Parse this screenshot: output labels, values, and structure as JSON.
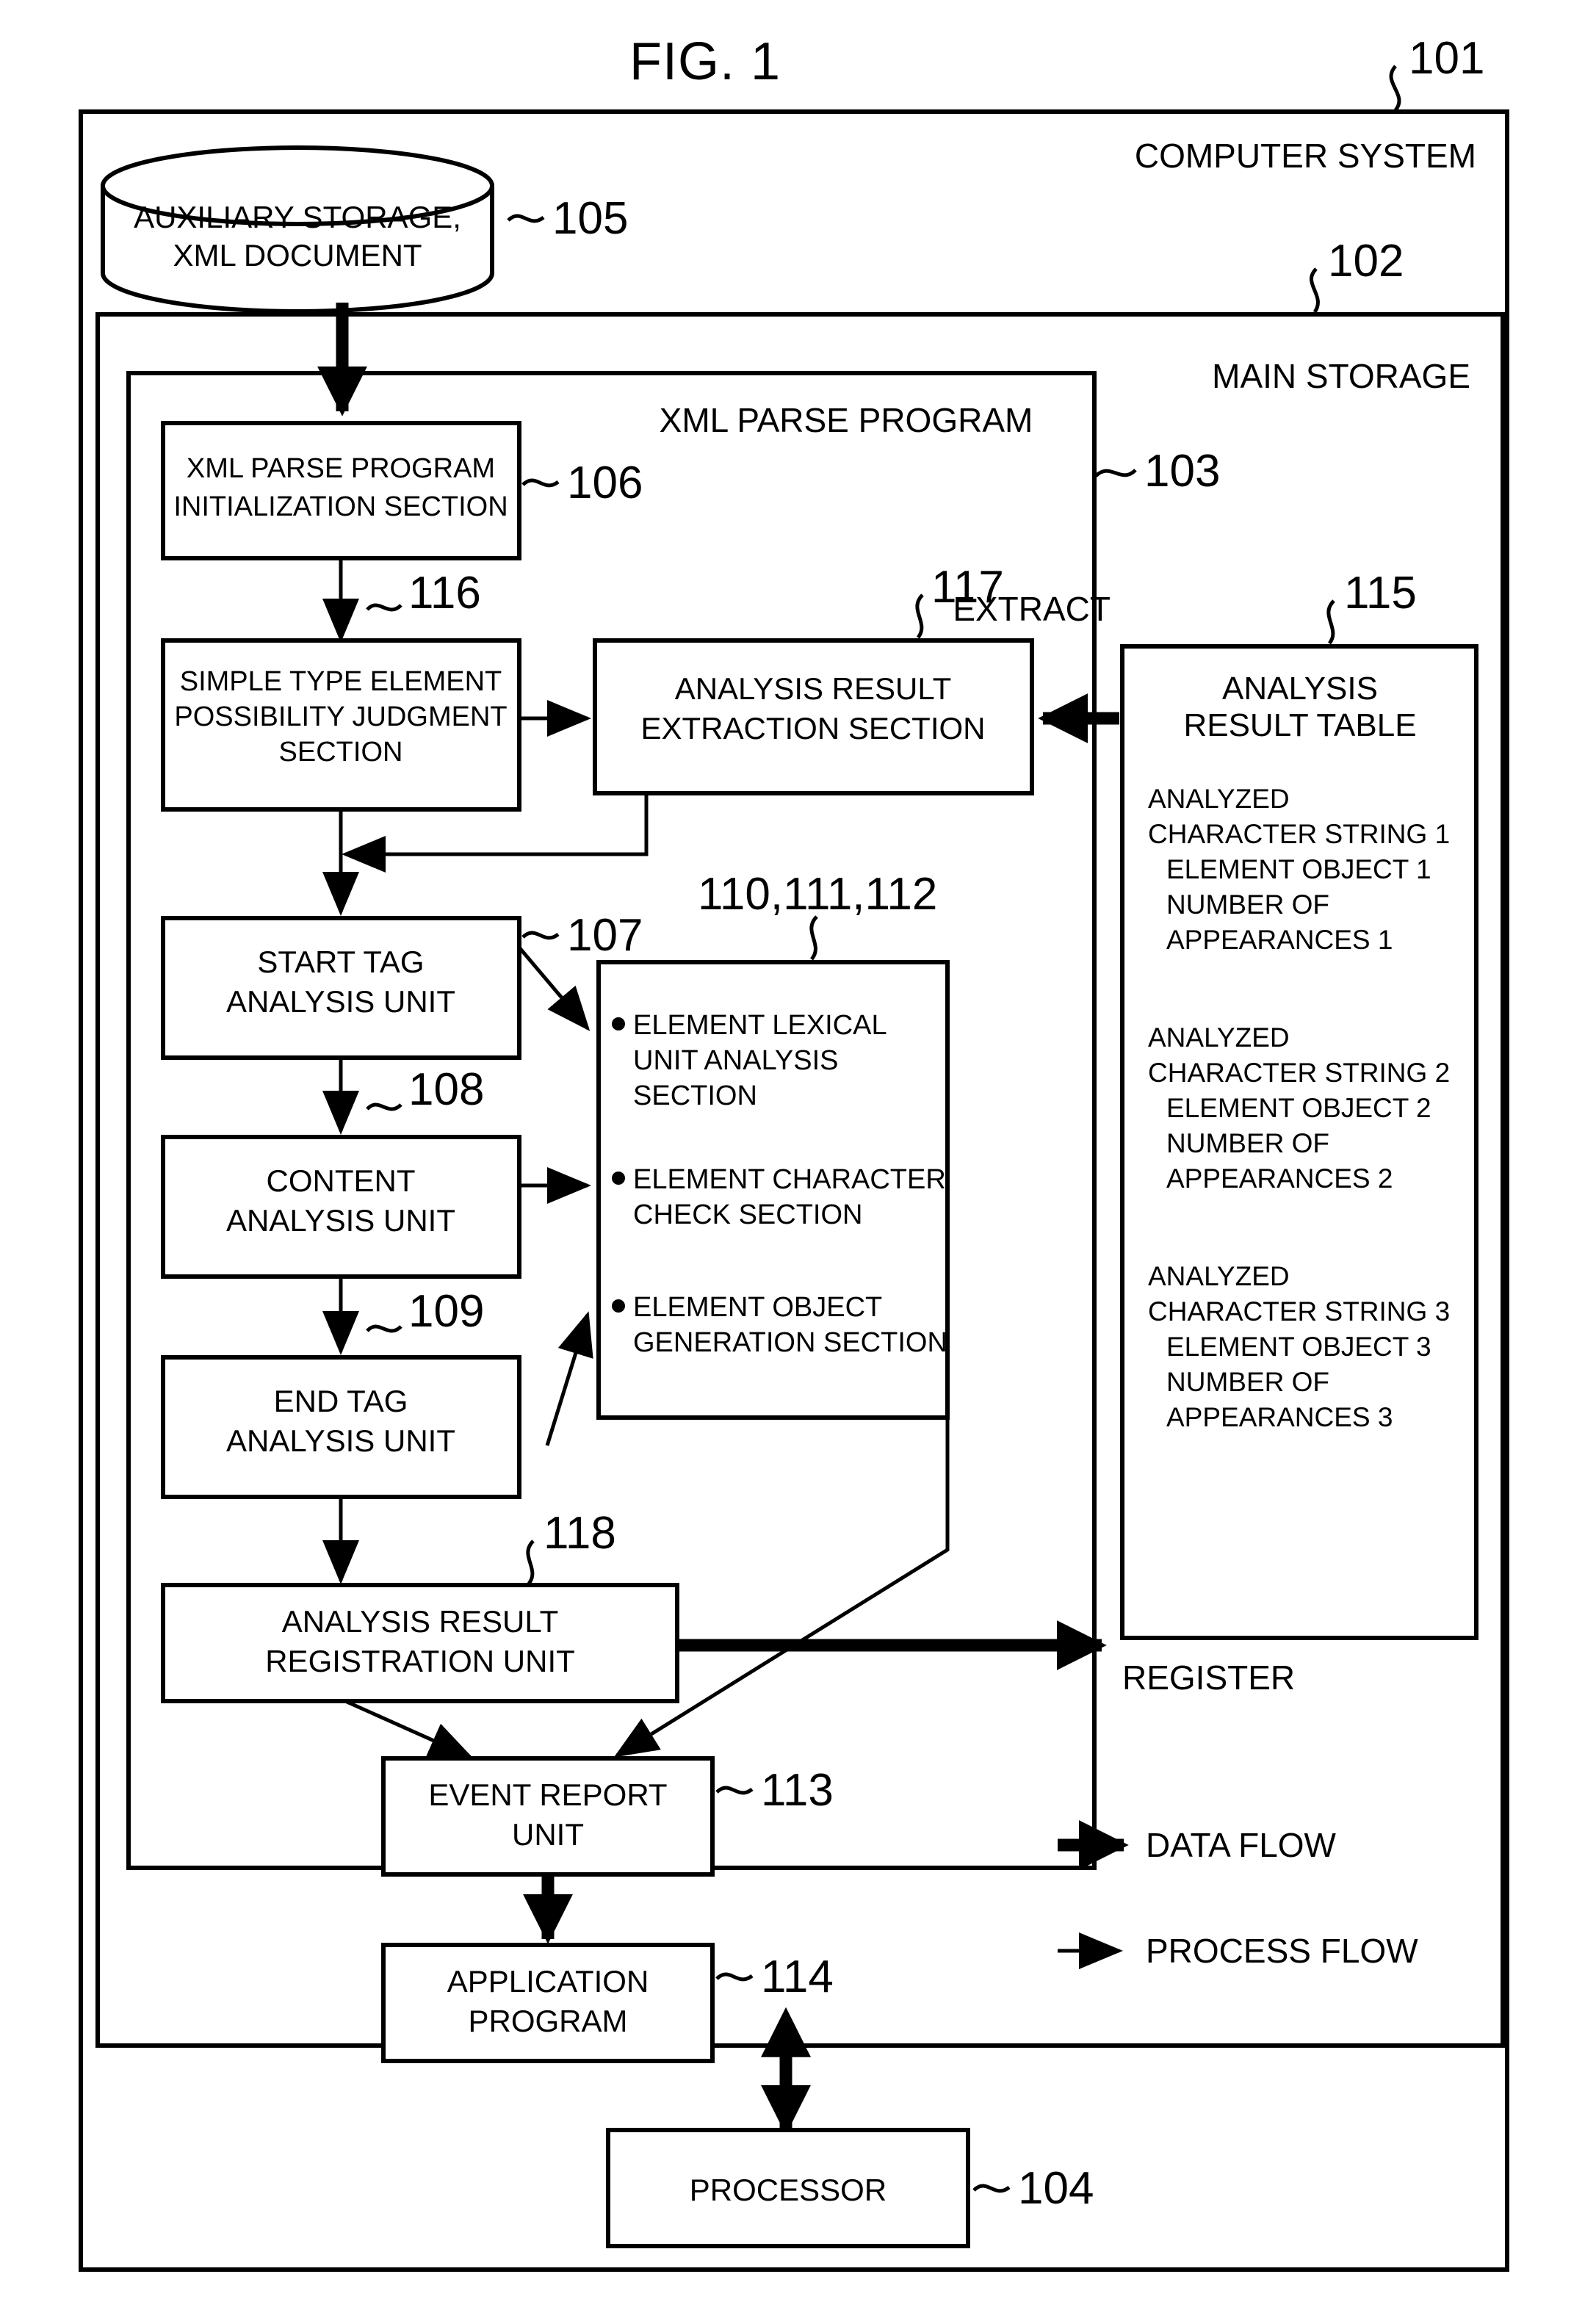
{
  "figure": {
    "title": "FIG. 1"
  },
  "outer": {
    "ref": "101",
    "label": "COMPUTER SYSTEM"
  },
  "main_storage": {
    "ref": "102",
    "label": "MAIN STORAGE"
  },
  "xml_parse_program": {
    "ref": "103",
    "label": "XML PARSE PROGRAM"
  },
  "auxiliary_storage": {
    "ref": "105",
    "line1": "AUXILIARY STORAGE,",
    "line2": "XML DOCUMENT"
  },
  "boxes": [
    {
      "ref": "106",
      "name": "xml-parse-program-initialization-section",
      "lines": [
        "XML PARSE PROGRAM",
        "INITIALIZATION SECTION"
      ]
    },
    {
      "ref": "116",
      "name": "simple-type-element-possibility-judgment-section",
      "lines": [
        "SIMPLE TYPE ELEMENT",
        "POSSIBILITY JUDGMENT",
        "SECTION"
      ]
    },
    {
      "ref": "117",
      "name": "analysis-result-extraction-section",
      "lines": [
        "ANALYSIS RESULT",
        "EXTRACTION SECTION"
      ]
    },
    {
      "ref": "107",
      "name": "start-tag-analysis-unit",
      "lines": [
        "START TAG",
        "ANALYSIS UNIT"
      ]
    },
    {
      "ref": "108",
      "name": "content-analysis-unit",
      "lines": [
        "CONTENT",
        "ANALYSIS UNIT"
      ]
    },
    {
      "ref": "109",
      "name": "end-tag-analysis-unit",
      "lines": [
        "END TAG",
        "ANALYSIS UNIT"
      ]
    },
    {
      "ref": "118",
      "name": "analysis-result-registration-unit",
      "lines": [
        "ANALYSIS RESULT",
        "REGISTRATION UNIT"
      ]
    },
    {
      "ref": "113",
      "name": "event-report-unit",
      "lines": [
        "EVENT REPORT",
        "UNIT"
      ]
    },
    {
      "ref": "114",
      "name": "application-program",
      "lines": [
        "APPLICATION",
        "PROGRAM"
      ]
    },
    {
      "ref": "104",
      "name": "processor",
      "lines": [
        "PROCESSOR"
      ]
    }
  ],
  "sections_box": {
    "ref": "110,111,112",
    "items": [
      [
        "ELEMENT LEXICAL",
        "UNIT ANALYSIS",
        "SECTION"
      ],
      [
        "ELEMENT CHARACTER",
        "CHECK SECTION"
      ],
      [
        "ELEMENT OBJECT",
        "GENERATION SECTION"
      ]
    ]
  },
  "analysis_result_table": {
    "ref": "115",
    "title_line1": "ANALYSIS",
    "title_line2": "RESULT TABLE",
    "extract_label": "EXTRACT",
    "register_label": "REGISTER",
    "entries": [
      [
        "ANALYZED",
        "CHARACTER STRING 1",
        "ELEMENT OBJECT 1",
        "NUMBER OF",
        "APPEARANCES 1"
      ],
      [
        "ANALYZED",
        "CHARACTER STRING 2",
        "ELEMENT OBJECT 2",
        "NUMBER OF",
        "APPEARANCES 2"
      ],
      [
        "ANALYZED",
        "CHARACTER STRING 3",
        "ELEMENT OBJECT 3",
        "NUMBER OF",
        "APPEARANCES 3"
      ]
    ]
  },
  "legend": {
    "data_flow": "DATA FLOW",
    "process_flow": "PROCESS FLOW"
  },
  "colors": {
    "ink": "#000000",
    "paper": "#ffffff"
  }
}
